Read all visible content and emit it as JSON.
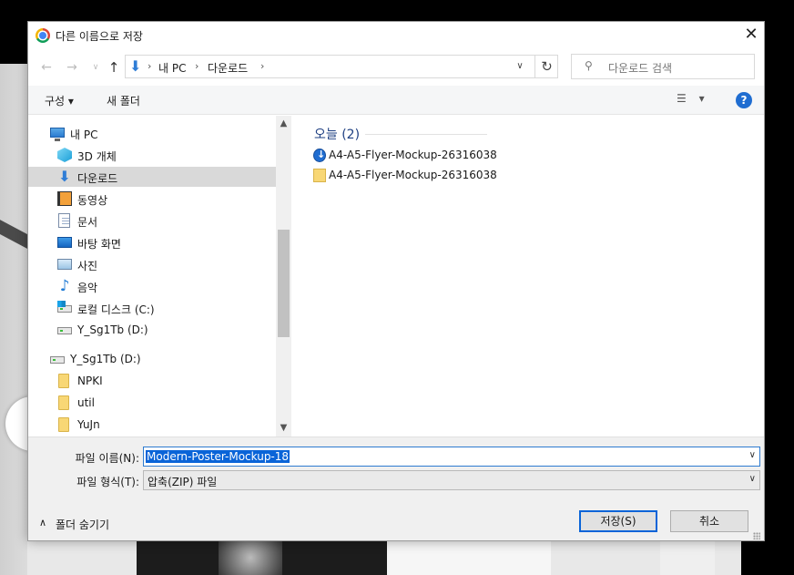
{
  "dialog": {
    "title": "다른 이름으로 저장",
    "close_symbol": "✕"
  },
  "nav": {
    "back_symbol": "←",
    "forward_symbol": "→",
    "recent_symbol": "∨",
    "up_symbol": "↑",
    "breadcrumb": [
      "내 PC",
      "다운로드"
    ],
    "refresh_symbol": "↻",
    "dropdown_symbol": "∨",
    "search_placeholder": "다운로드 검색"
  },
  "toolbar": {
    "organize_label": "구성 ▾",
    "new_folder_label": "새 폴더",
    "view_label": "▾",
    "help_label": "?"
  },
  "navpane": {
    "items": [
      {
        "label": "내 PC",
        "icon": "computer-icon"
      },
      {
        "label": "3D 개체",
        "icon": "3d-objects-icon"
      },
      {
        "label": "다운로드",
        "icon": "downloads-icon",
        "selected": true
      },
      {
        "label": "동영상",
        "icon": "videos-icon"
      },
      {
        "label": "문서",
        "icon": "documents-icon"
      },
      {
        "label": "바탕 화면",
        "icon": "desktop-icon"
      },
      {
        "label": "사진",
        "icon": "pictures-icon"
      },
      {
        "label": "음악",
        "icon": "music-icon"
      },
      {
        "label": "로컬 디스크 (C:)",
        "icon": "local-disk-icon"
      },
      {
        "label": "Y_Sg1Tb (D:)",
        "icon": "drive-icon"
      },
      {
        "label": "Y_Sg1Tb (D:)",
        "icon": "drive-icon"
      },
      {
        "label": "NPKI",
        "icon": "folder-icon"
      },
      {
        "label": "util",
        "icon": "folder-icon"
      },
      {
        "label": "YuJn",
        "icon": "folder-icon"
      }
    ]
  },
  "filepane": {
    "group_header": "오늘 (2)",
    "files": [
      {
        "name": "A4-A5-Flyer-Mockup-26316038",
        "icon": "chrome-download-icon"
      },
      {
        "name": "A4-A5-Flyer-Mockup-26316038",
        "icon": "folder-icon"
      }
    ]
  },
  "form": {
    "filename_label": "파일 이름(N):",
    "filename_value": "Modern-Poster-Mockup-18",
    "filetype_label": "파일 형식(T):",
    "filetype_value": "압축(ZIP) 파일",
    "hide_folders_label": "폴더 숨기기",
    "save_label": "저장(S)",
    "cancel_label": "취소"
  },
  "colors": {
    "accent": "#0a64d8",
    "selected_item": "#d9d9d9",
    "folder": "#f8d775"
  }
}
